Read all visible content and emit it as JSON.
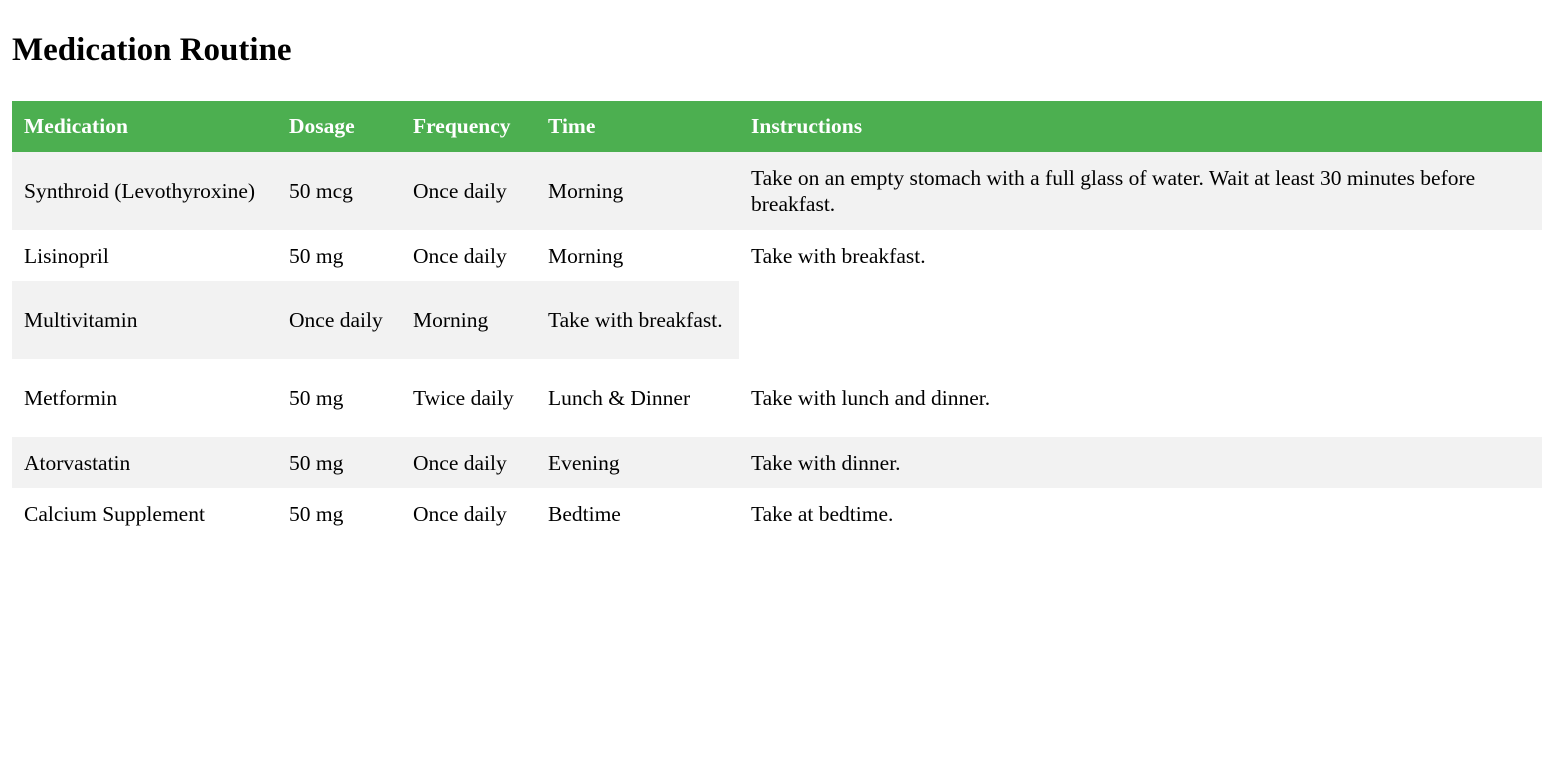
{
  "page": {
    "title": "Medication Routine"
  },
  "colors": {
    "header_bg": "#4caf50",
    "header_text": "#ffffff",
    "row_shade": "#f2f2f2"
  },
  "table": {
    "headers": [
      "Medication",
      "Dosage",
      "Frequency",
      "Time",
      "Instructions"
    ],
    "rows": [
      {
        "cells": [
          "Synthroid (Levothyroxine)",
          "50 mcg",
          "Once daily",
          "Morning",
          "Take on an empty stomach with a full glass of water. Wait at least 30 minutes before breakfast."
        ]
      },
      {
        "cells": [
          "Lisinopril",
          "50 mg",
          "Once daily",
          "Morning",
          "Take with breakfast."
        ]
      },
      {
        "cells": [
          "Multivitamin",
          "Once daily",
          "Morning",
          "Take with breakfast."
        ]
      },
      {
        "cells": [
          "Metformin",
          "50 mg",
          "Twice daily",
          "Lunch & Dinner",
          "Take with lunch and dinner."
        ]
      },
      {
        "cells": [
          "Atorvastatin",
          "50 mg",
          "Once daily",
          "Evening",
          "Take with dinner."
        ]
      },
      {
        "cells": [
          "Calcium Supplement",
          "50 mg",
          "Once daily",
          "Bedtime",
          "Take at bedtime."
        ]
      }
    ]
  }
}
